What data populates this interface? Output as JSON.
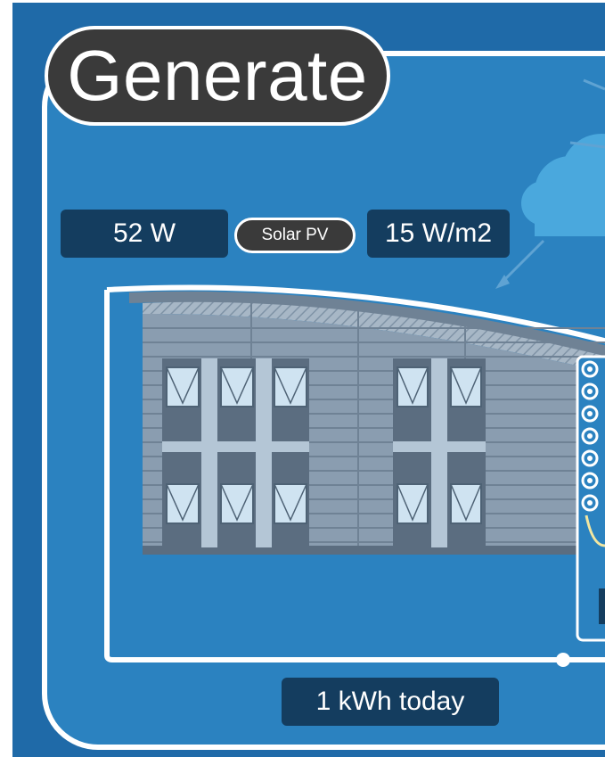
{
  "panel": {
    "title": "Generate",
    "power": "52 W",
    "source": "Solar PV",
    "irradiance": "15 W/m2",
    "energy_today": "1 kWh today"
  },
  "colors": {
    "page_bg": "#ffffff",
    "outer_blue": "#1f6aa8",
    "panel_blue": "#2b82c0",
    "readout_bg": "#143d5f",
    "pill_bg": "#3a3a3a",
    "building_wall": "#8a9db0",
    "window_glass": "#cfe3f1",
    "window_frame": "#4e6275",
    "cloud": "#4aa8dd"
  },
  "icons": {
    "cloud": "cloud-icon",
    "sun_ray": "arrow-icon",
    "heat_pump": "coil-icon"
  }
}
